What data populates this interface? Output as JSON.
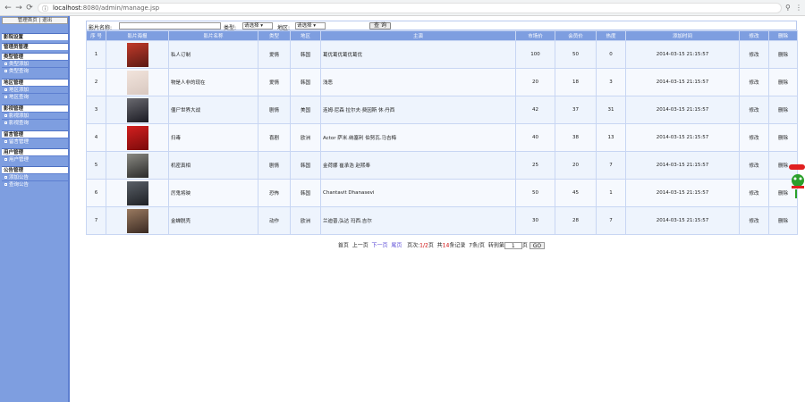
{
  "browser": {
    "url_host": "localhost",
    "url_rest": ":8080/admin/manage.jsp"
  },
  "sidebar": {
    "top_home": "管理首页",
    "top_sep": "|",
    "top_logout": "退出",
    "groups": [
      {
        "head": "影院设置",
        "items": []
      },
      {
        "head": "管理员管理",
        "items": []
      },
      {
        "head": "类型管理",
        "items": [
          "类型添加",
          "类型查询"
        ]
      },
      {
        "head": "地区管理",
        "items": [
          "地区添加",
          "地区查询"
        ]
      },
      {
        "head": "影视管理",
        "items": [
          "影视添加",
          "影视查询"
        ]
      },
      {
        "head": "留言管理",
        "items": [
          "留言管理"
        ]
      },
      {
        "head": "用户管理",
        "items": [
          "用户管理"
        ]
      },
      {
        "head": "公告管理",
        "items": [
          "添加公告",
          "查询公告"
        ]
      }
    ]
  },
  "search": {
    "name_label": "影片名称:",
    "type_label": "类型:",
    "type_selected": "请选择",
    "region_label": "地区:",
    "region_selected": "请选择",
    "button": "查 询"
  },
  "table": {
    "headers": [
      "序 号",
      "影片海报",
      "影片名称",
      "类型",
      "地区",
      "主演",
      "市场价",
      "会员价",
      "热度",
      "添加时间",
      "修改",
      "删除"
    ],
    "rows": [
      {
        "no": "1",
        "name": "私人订制",
        "type": "爱情",
        "region": "韩国",
        "actors": "葛优葛优葛优葛优",
        "market": "100",
        "member": "50",
        "hot": "0",
        "time": "2014-03-15 21:15:57",
        "edit": "修改",
        "del": "删除"
      },
      {
        "no": "2",
        "name": "物是人非的现在",
        "type": "爱情",
        "region": "韩国",
        "actors": "浅恶",
        "market": "20",
        "member": "18",
        "hot": "3",
        "time": "2014-03-15 21:15:57",
        "edit": "修改",
        "del": "删除"
      },
      {
        "no": "3",
        "name": "僵尸世界大战",
        "type": "剧情",
        "region": "美国",
        "actors": "连姆·尼森 拉尔夫·费因斯 休·丹西",
        "market": "42",
        "member": "37",
        "hot": "31",
        "time": "2014-03-15 21:15:57",
        "edit": "修改",
        "del": "删除"
      },
      {
        "no": "4",
        "name": "扫毒",
        "type": "喜剧",
        "region": "欧洲",
        "actors": "Actor 萨米.纳塞利 伯努瓦.马吉梅",
        "market": "40",
        "member": "38",
        "hot": "13",
        "time": "2014-03-15 21:15:57",
        "edit": "修改",
        "del": "删除"
      },
      {
        "no": "5",
        "name": "机密真相",
        "type": "剧情",
        "region": "韩国",
        "actors": "金荷娜 崔承浩 赵熙奉",
        "market": "25",
        "member": "20",
        "hot": "7",
        "time": "2014-03-15 21:15:57",
        "edit": "修改",
        "del": "删除"
      },
      {
        "no": "6",
        "name": "厉鬼将映",
        "type": "恐怖",
        "region": "韩国",
        "actors": "Chantavit Dhanasevi",
        "market": "50",
        "member": "45",
        "hot": "1",
        "time": "2014-03-15 21:15:57",
        "edit": "修改",
        "del": "删除"
      },
      {
        "no": "7",
        "name": "金蝉脱壳",
        "type": "动作",
        "region": "欧洲",
        "actors": "兰迪普,弘达 玛西.吉尔",
        "market": "30",
        "member": "28",
        "hot": "7",
        "time": "2014-03-15 21:15:57",
        "edit": "修改",
        "del": "删除"
      }
    ]
  },
  "pager": {
    "first": "首页",
    "prev": "上一页",
    "next": "下一页",
    "last": "尾页",
    "page_label": "页次:",
    "page_value": "1/2",
    "page_unit": "页",
    "total_pre": "共",
    "total": "14",
    "total_post": "条记录",
    "per_page": "7条/页",
    "jump": "转到第",
    "jump_value": "1",
    "jump_unit": "页",
    "go": "GO"
  },
  "colors": {
    "accent": "#7e9ee0",
    "link": "#5b4bd6"
  }
}
